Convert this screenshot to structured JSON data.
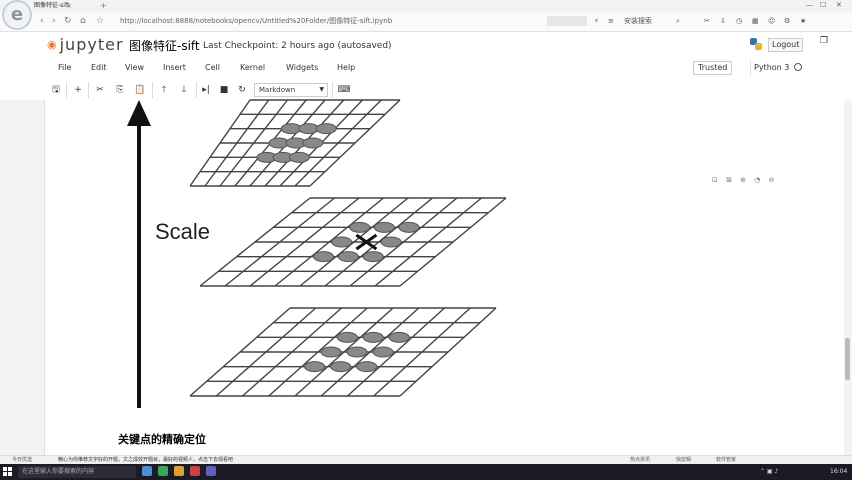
{
  "browser": {
    "tab_title": "图像特征-sift",
    "url": "http://localhost:8888/notebooks/opencv/Untitled%20Folder/图像特征-sift.ipynb",
    "logo_letter": "e",
    "right_label": "安装搜索"
  },
  "notebook": {
    "brand": "jupyter",
    "name": "图像特征-sift",
    "checkpoint": "Last Checkpoint: 2 hours ago (autosaved)",
    "logout_label": "Logout"
  },
  "menu": {
    "items": [
      "File",
      "Edit",
      "View",
      "Insert",
      "Cell",
      "Kernel",
      "Widgets",
      "Help"
    ],
    "trusted_label": "Trusted",
    "kernel_name": "Python 3"
  },
  "toolbar": {
    "cell_type": "Markdown"
  },
  "figure": {
    "scale_label": "Scale",
    "caption": "关键点的精确定位"
  },
  "statusbar": {
    "left": "今日优选",
    "message": "精心为你推荐文字好的开题，文之成效开题目，最好的视频人，点击下去观看吧",
    "right_items": [
      "热点资讯",
      "快剪辑",
      "软件管家"
    ]
  },
  "taskbar": {
    "search_placeholder": "在这里输入你要搜索的内容",
    "clock": "16:04"
  },
  "colors": {
    "accent_orange": "#f37726",
    "taskbar_bg": "#1b1b26"
  }
}
